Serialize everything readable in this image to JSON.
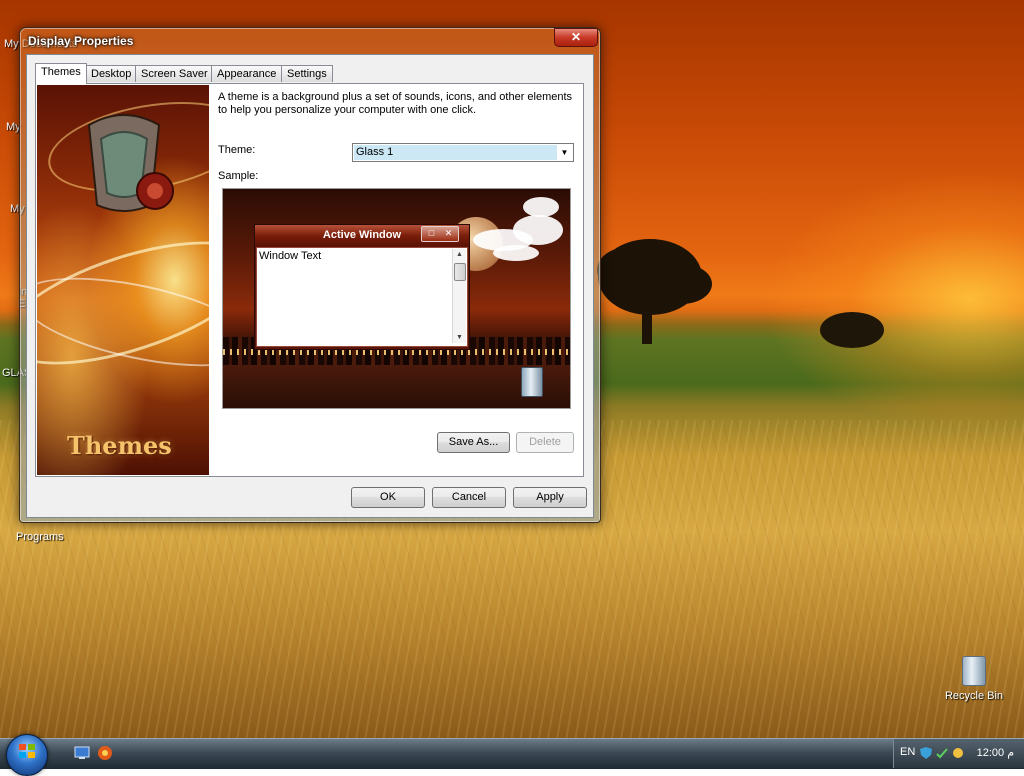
{
  "window": {
    "title": "Display Properties",
    "close_label": "✕"
  },
  "tabs": [
    {
      "label": "Themes",
      "active": true
    },
    {
      "label": "Desktop",
      "active": false
    },
    {
      "label": "Screen Saver",
      "active": false
    },
    {
      "label": "Appearance",
      "active": false
    },
    {
      "label": "Settings",
      "active": false
    }
  ],
  "themes_panel": {
    "banner_text": "Themes",
    "description": "A theme is a background plus a set of sounds, icons, and other elements to help you personalize your computer with one click.",
    "theme_label": "Theme:",
    "theme_value": "Glass 1",
    "sample_label": "Sample:",
    "sample": {
      "window_title": "Active Window",
      "window_text": "Window Text"
    },
    "save_as_label": "Save As...",
    "delete_label": "Delete"
  },
  "footer": {
    "ok_label": "OK",
    "cancel_label": "Cancel",
    "apply_label": "Apply"
  },
  "desktop": {
    "icons": [
      {
        "label": "My Documents"
      },
      {
        "label": "My"
      },
      {
        "label": "My"
      },
      {
        "label": "In"
      },
      {
        "label": "E"
      },
      {
        "label": "GLAS"
      },
      {
        "label": "Programs"
      },
      {
        "label": "Recycle Bin"
      }
    ]
  },
  "taskbar": {
    "language": "EN",
    "clock": "12:00 م"
  },
  "colors": {
    "close_button": "#c73a26",
    "selection": "#cde8f5"
  }
}
